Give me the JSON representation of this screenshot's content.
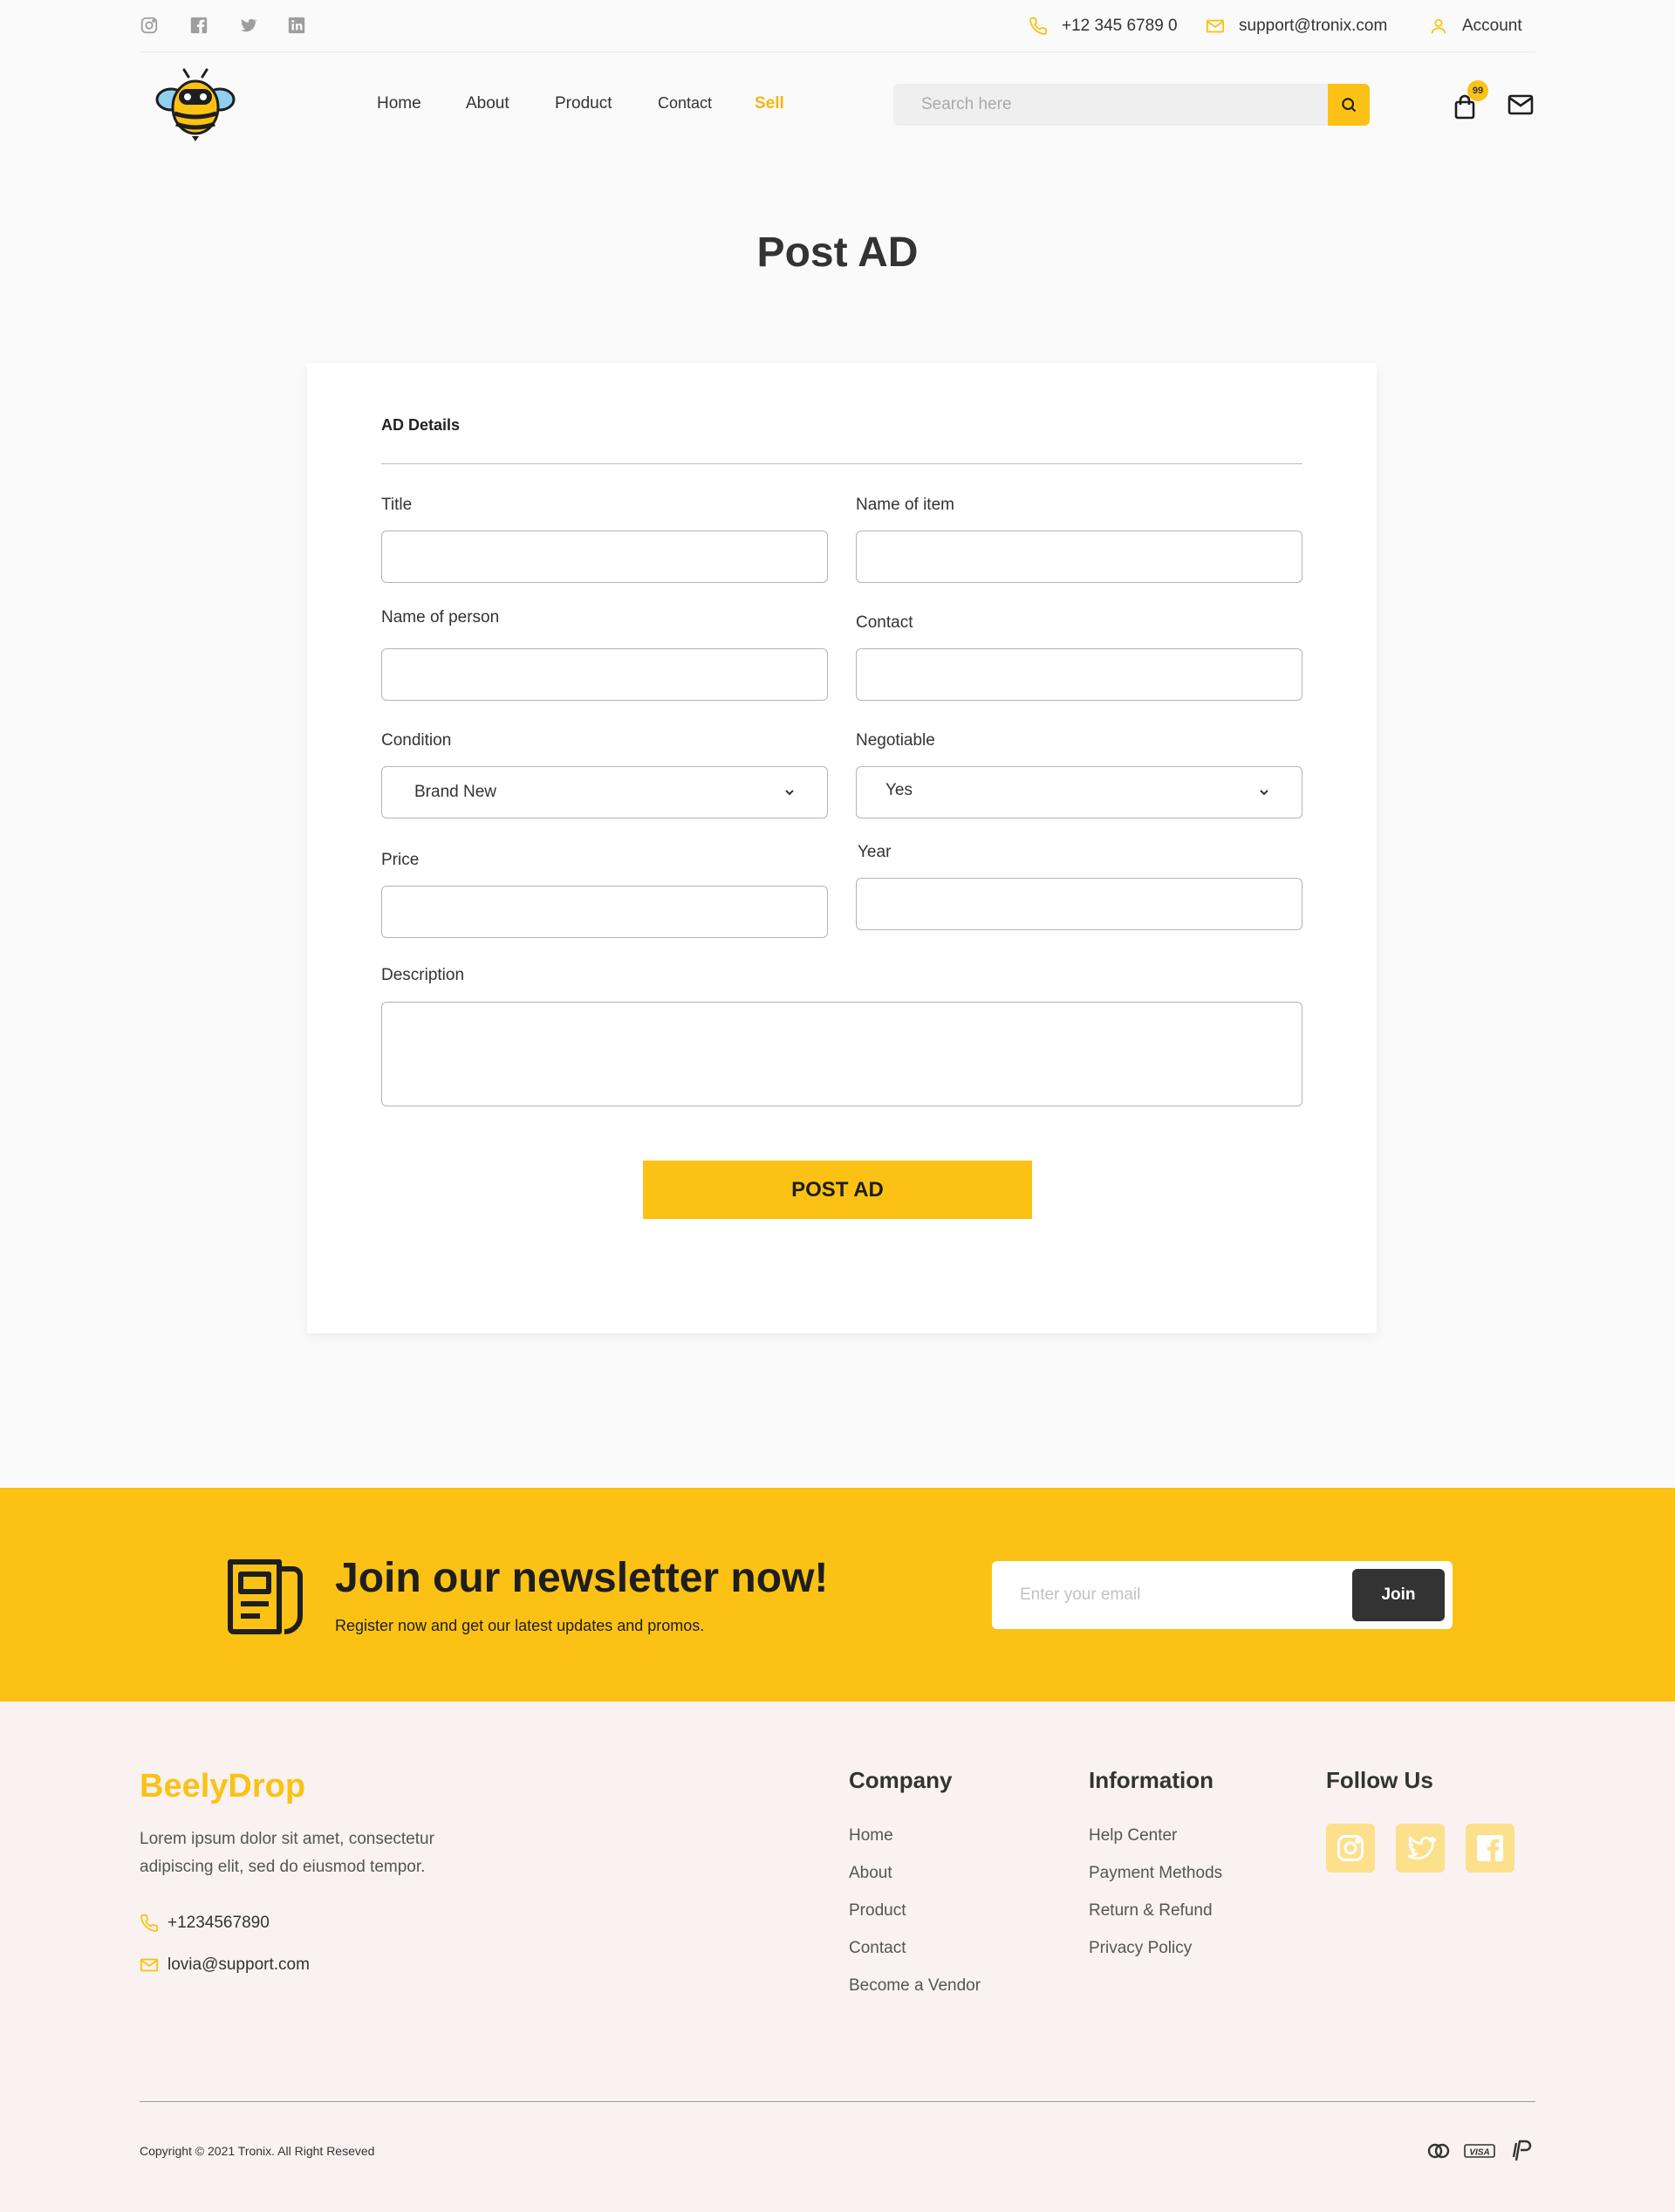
{
  "colors": {
    "accent": "#fbc215",
    "dark": "#333333",
    "footer_bg": "#f9f2f1"
  },
  "topbar": {
    "social_icons": [
      "instagram-icon",
      "facebook-icon",
      "twitter-icon",
      "linkedin-icon"
    ],
    "phone": "+12 345 6789 0",
    "email": "support@tronix.com",
    "account": "Account"
  },
  "nav": {
    "items": [
      {
        "label": "Home",
        "active": false
      },
      {
        "label": "About",
        "active": false
      },
      {
        "label": "Product",
        "active": false
      },
      {
        "label": "Contact",
        "active": false
      },
      {
        "label": "Sell",
        "active": true
      }
    ],
    "search_placeholder": "Search here",
    "cart_count": "99"
  },
  "page": {
    "title": "Post AD"
  },
  "form": {
    "section_title": "AD Details",
    "fields": {
      "title": {
        "label": "Title",
        "value": ""
      },
      "item_name": {
        "label": "Name of item",
        "value": ""
      },
      "person_name": {
        "label": "Name of person",
        "value": ""
      },
      "contact": {
        "label": "Contact",
        "value": ""
      },
      "condition": {
        "label": "Condition",
        "value": "Brand New"
      },
      "negotiable": {
        "label": "Negotiable",
        "value": "Yes"
      },
      "price": {
        "label": "Price",
        "value": ""
      },
      "year": {
        "label": "Year",
        "value": ""
      },
      "description": {
        "label": "Description",
        "value": ""
      }
    },
    "submit_label": "POST AD"
  },
  "newsletter": {
    "title": "Join our newsletter now!",
    "subtitle": "Register now and get our latest updates and promos.",
    "email_placeholder": "Enter your email",
    "join_label": "Join"
  },
  "footer": {
    "brand": "BeelyDrop",
    "description": "Lorem ipsum dolor sit amet, consectetur adipiscing elit, sed do eiusmod tempor.",
    "phone": "+1234567890",
    "email": "lovia@support.com",
    "company": {
      "heading": "Company",
      "links": [
        "Home",
        "About",
        "Product",
        "Contact",
        "Become a Vendor"
      ]
    },
    "information": {
      "heading": "Information",
      "links": [
        "Help Center",
        "Payment Methods",
        "Return & Refund",
        "Privacy Policy"
      ]
    },
    "follow": {
      "heading": "Follow Us",
      "icons": [
        "instagram-icon",
        "twitter-icon",
        "facebook-icon"
      ]
    },
    "copyright": "Copyright © 2021 Tronix. All Right Reseved",
    "payment_icons": [
      "mastercard-icon",
      "visa-icon",
      "paypal-icon"
    ],
    "payment_labels": {
      "visa": "VISA"
    }
  }
}
